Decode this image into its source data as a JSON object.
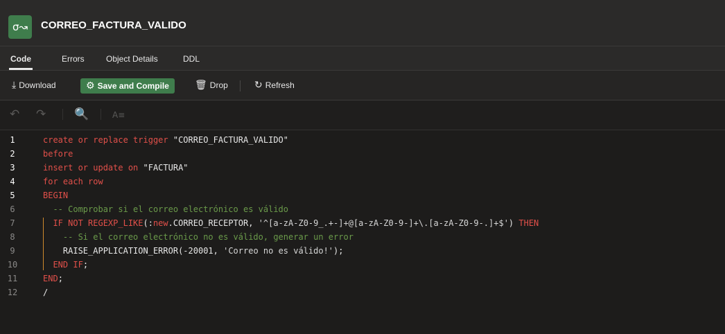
{
  "title": {
    "text": "CORREO_FACTURA_VALIDO",
    "icon": "trigger-icon"
  },
  "tabs": [
    {
      "label": "Code",
      "active": true
    },
    {
      "label": "Errors"
    },
    {
      "label": "Object Details"
    },
    {
      "label": "DDL"
    }
  ],
  "toolbar": {
    "download_label": "Download",
    "save_label": "Save and Compile",
    "drop_label": "Drop",
    "refresh_label": "Refresh"
  },
  "colors": {
    "accent": "#3f7d4c",
    "keyword": "#e2504a",
    "comment": "#6a9a4a"
  },
  "code": {
    "line_numbers": [
      "1",
      "2",
      "3",
      "4",
      "5",
      "6",
      "7",
      "8",
      "9",
      "10",
      "11",
      "12"
    ],
    "lines": [
      [
        {
          "t": "create or replace trigger ",
          "c": "kw"
        },
        {
          "t": "\"CORREO_FACTURA_VALIDO\"",
          "c": "id"
        }
      ],
      [
        {
          "t": "before",
          "c": "kw"
        }
      ],
      [
        {
          "t": "insert or update on ",
          "c": "kw"
        },
        {
          "t": "\"FACTURA\"",
          "c": "id"
        }
      ],
      [
        {
          "t": "for each row",
          "c": "kw"
        }
      ],
      [
        {
          "t": "BEGIN",
          "c": "kw"
        }
      ],
      [
        {
          "t": "  -- Comprobar si el correo electrónico es válido",
          "c": "cm"
        }
      ],
      [
        {
          "t": "  IF NOT REGEXP_LIKE",
          "c": "kw"
        },
        {
          "t": "(:",
          "c": "id"
        },
        {
          "t": "new",
          "c": "kw"
        },
        {
          "t": ".CORREO_RECEPTOR, ",
          "c": "id"
        },
        {
          "t": "'^[a-zA-Z0-9_.+-]+@[a-zA-Z0-9-]+\\.[a-zA-Z0-9-.]+$'",
          "c": "str"
        },
        {
          "t": ") ",
          "c": "id"
        },
        {
          "t": "THEN",
          "c": "kw"
        }
      ],
      [
        {
          "t": "    -- Si el correo electrónico no es válido, generar un error",
          "c": "cm"
        }
      ],
      [
        {
          "t": "    RAISE_APPLICATION_ERROR(-20001, ",
          "c": "id"
        },
        {
          "t": "'Correo no es válido!'",
          "c": "str"
        },
        {
          "t": ");",
          "c": "id"
        }
      ],
      [
        {
          "t": "  ",
          "c": "id"
        },
        {
          "t": "END IF",
          "c": "kw"
        },
        {
          "t": ";",
          "c": "id"
        }
      ],
      [
        {
          "t": "END",
          "c": "kw"
        },
        {
          "t": ";",
          "c": "id"
        }
      ],
      [
        {
          "t": "/",
          "c": "id"
        }
      ]
    ]
  }
}
